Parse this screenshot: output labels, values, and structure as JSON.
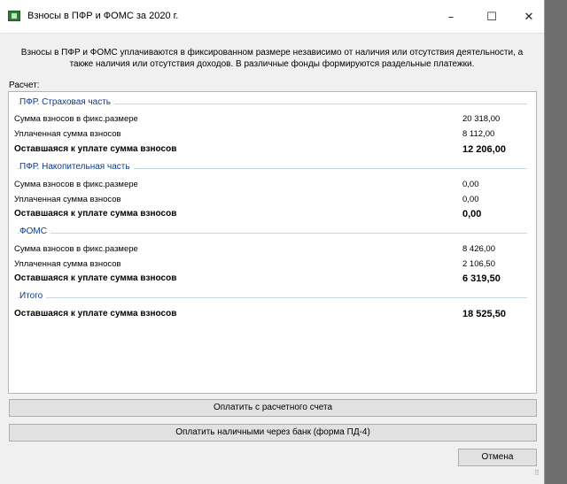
{
  "window": {
    "title": "Взносы в ПФР и ФОМС за 2020 г."
  },
  "controls": {
    "minimize": "–",
    "maximize": "☐",
    "close": "✕"
  },
  "description": {
    "line1": "Взносы в ПФР и ФОМС уплачиваются в фиксированном размере независимо от наличия или отсутствия деятельности, а",
    "line2": "также наличия или отсутствия доходов. В различные фонды формируются раздельные платежки."
  },
  "calc_label": "Расчет:",
  "groups": [
    {
      "title": "ПФР. Страховая часть",
      "rows": [
        {
          "label": "Сумма взносов в фикс.размере",
          "value": "20 318,00"
        },
        {
          "label": "Уплаченная сумма взносов",
          "value": "8 112,00"
        },
        {
          "label": "Оставшаяся к уплате сумма взносов",
          "value": "12 206,00"
        }
      ]
    },
    {
      "title": "ПФР. Накопительная часть",
      "rows": [
        {
          "label": "Сумма взносов в фикс.размере",
          "value": "0,00"
        },
        {
          "label": "Уплаченная сумма взносов",
          "value": "0,00"
        },
        {
          "label": "Оставшаяся к уплате сумма взносов",
          "value": "0,00"
        }
      ]
    },
    {
      "title": "ФОМС",
      "rows": [
        {
          "label": "Сумма взносов в фикс.размере",
          "value": "8 426,00"
        },
        {
          "label": "Уплаченная сумма взносов",
          "value": "2 106,50"
        },
        {
          "label": "Оставшаяся к уплате сумма взносов",
          "value": "6 319,50"
        }
      ]
    },
    {
      "title": "Итого",
      "rows": [
        {
          "label": "Оставшаяся к уплате сумма взносов",
          "value": "18 525,50"
        }
      ]
    }
  ],
  "buttons": {
    "pay_account": "Оплатить с расчетного счета",
    "pay_cash": "Оплатить наличными через банк (форма ПД-4)",
    "cancel": "Отмена"
  }
}
